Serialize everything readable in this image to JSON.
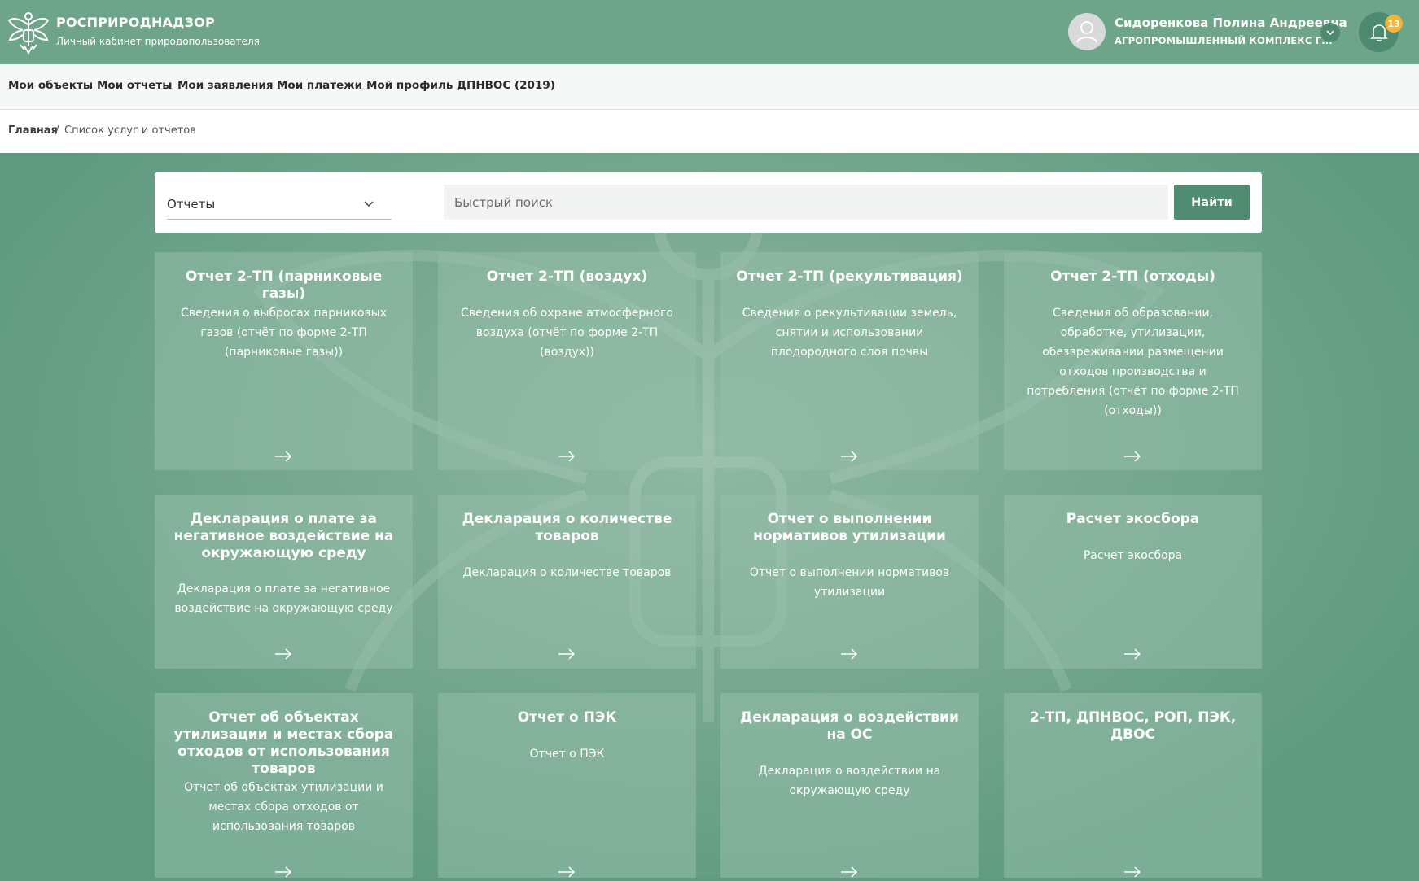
{
  "header": {
    "brand_name": "РОСПРИРОДНАДЗОР",
    "brand_sub": "Личный кабинет природопользователя",
    "user_name": "Сидоренкова Полина Андреевна",
    "user_org": "АГРОПРОМЫШЛЕННЫЙ КОМПЛЕКС Г...",
    "notifications_count": "13"
  },
  "nav": {
    "items": [
      "Мои объекты",
      "Мои отчеты",
      "Мои заявления",
      "Мои платежи",
      "Мой профиль",
      "ДПНВОС (2019)"
    ]
  },
  "breadcrumb": {
    "home": "Главная",
    "separator": "/",
    "current": "Список услуг и отчетов"
  },
  "search": {
    "category": "Отчеты",
    "placeholder": "Быстрый поиск",
    "button": "Найти"
  },
  "cards": [
    {
      "title": "Отчет 2-ТП (парниковые газы)",
      "desc": "Сведения о выбросах парниковых газов (отчёт по форме 2-ТП (парниковые газы))"
    },
    {
      "title": "Отчет 2-ТП (воздух)",
      "desc": "Сведения об охране атмосферного воздуха (отчёт по форме 2-ТП (воздух))"
    },
    {
      "title": "Отчет 2-ТП (рекультивация)",
      "desc": "Сведения о рекультивации земель, снятии и использовании плодородного слоя почвы"
    },
    {
      "title": "Отчет 2-ТП (отходы)",
      "desc": "Сведения об образовании, обработке, утилизации, обезвреживании размещении отходов производства и потребления (отчёт по форме 2-ТП (отходы))"
    },
    {
      "title": "Декларация о плате за негативное воздействие на окружающую среду",
      "desc": "Декларация о плате за негативное воздействие на окружающую среду"
    },
    {
      "title": "Декларация о количестве товаров",
      "desc": "Декларация о количестве товаров"
    },
    {
      "title": "Отчет о выполнении нормативов утилизации",
      "desc": "Отчет о выполнении нормативов утилизации"
    },
    {
      "title": "Расчет экосбора",
      "desc": "Расчет экосбора"
    },
    {
      "title": "Отчет об объектах утилизации и местах сбора отходов от использования товаров",
      "desc": "Отчет об объектах утилизации и местах сбора отходов от использования товаров"
    },
    {
      "title": "Отчет о ПЭК",
      "desc": "Отчет о ПЭК"
    },
    {
      "title": "Декларация о воздействии на ОС",
      "desc": "Декларация о воздействии на окружающую среду"
    },
    {
      "title": "2-ТП, ДПНВОС, РОП, ПЭК, ДВОС",
      "desc": ""
    }
  ]
}
